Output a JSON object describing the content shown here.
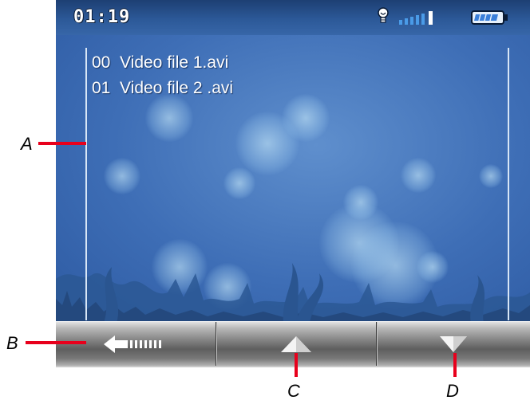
{
  "status_bar": {
    "time": "01:19",
    "icons": [
      "bulb-icon",
      "signal-strength-icon",
      "battery-icon"
    ]
  },
  "file_list": {
    "items": [
      "00  Video file 1.avi",
      "01  Video file 2 .avi"
    ]
  },
  "toolbar": {
    "buttons": [
      "back-arrow-icon",
      "up-arrow-icon",
      "down-arrow-icon"
    ]
  },
  "callouts": {
    "a": "A",
    "b": "B",
    "c": "C",
    "d": "D"
  },
  "colors": {
    "screen_background": "#3e6eb6",
    "callout_line": "#e8001c",
    "battery_fill": "#3b7fd9"
  }
}
